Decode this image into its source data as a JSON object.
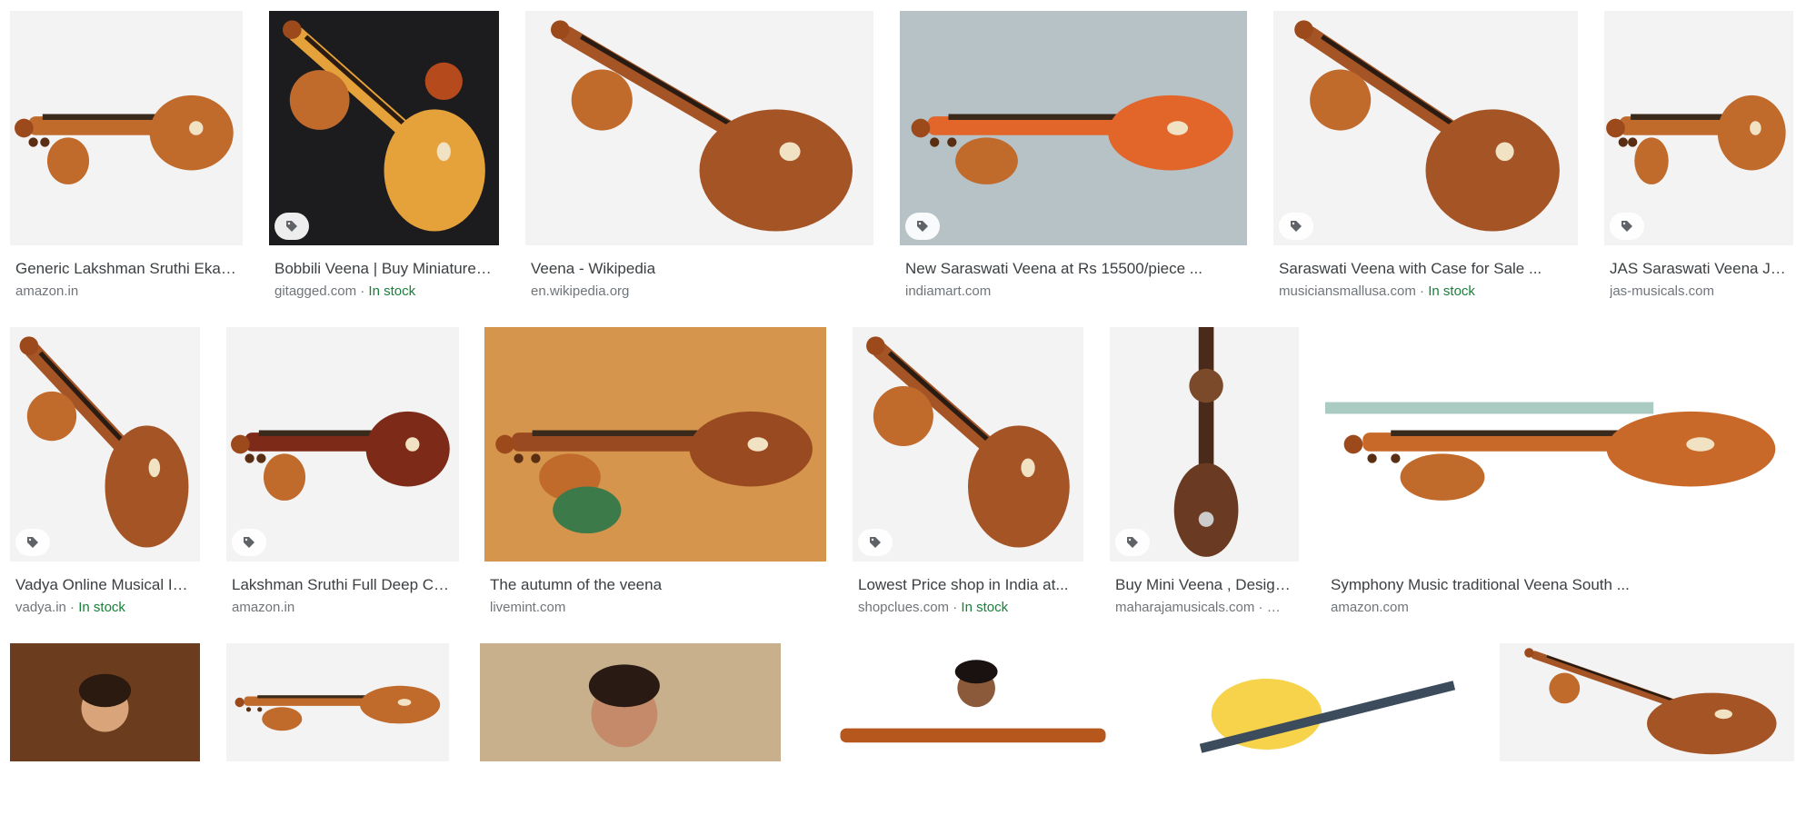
{
  "results": [
    {
      "title": "Generic Lakshman Sruthi Ekanda Veena",
      "source": "amazon.in",
      "stock": "",
      "tag_icon": false,
      "variant": "h-light"
    },
    {
      "title": "Bobbili Veena | Buy Miniature Veena",
      "source": "gitagged.com",
      "stock": "In stock",
      "tag_icon": true,
      "variant": "d-dark"
    },
    {
      "title": "Veena - Wikipedia",
      "source": "en.wikipedia.org",
      "stock": "",
      "tag_icon": false,
      "variant": "d-light"
    },
    {
      "title": "New Saraswati Veena at Rs 15500/piece ...",
      "source": "indiamart.com",
      "stock": "",
      "tag_icon": true,
      "variant": "h-orange"
    },
    {
      "title": "Saraswati Veena with Case for Sale ...",
      "source": "musiciansmallusa.com",
      "stock": "In stock",
      "tag_icon": true,
      "variant": "d-light"
    },
    {
      "title": "JAS Saraswati Veena JAS",
      "source": "jas-musicals.com",
      "stock": "",
      "tag_icon": true,
      "variant": "h-light"
    },
    {
      "title": "Vadya Online Musical Instruments",
      "source": "vadya.in",
      "stock": "In stock",
      "tag_icon": true,
      "variant": "d-light"
    },
    {
      "title": "Lakshman Sruthi Full Deep Carved Veena",
      "source": "amazon.in",
      "stock": "",
      "tag_icon": true,
      "variant": "h-red"
    },
    {
      "title": "The autumn of the veena",
      "source": "livemint.com",
      "stock": "",
      "tag_icon": false,
      "variant": "warm"
    },
    {
      "title": "Lowest Price shop in India at...",
      "source": "shopclues.com",
      "stock": "In stock",
      "tag_icon": true,
      "variant": "d-light"
    },
    {
      "title": "Buy Mini Veena , Designer Mini Veena",
      "source": "maharajamusicals.com · …",
      "stock": "",
      "tag_icon": true,
      "variant": "vertical"
    },
    {
      "title": "Symphony Music traditional Veena South ...",
      "source": "amazon.com",
      "stock": "",
      "tag_icon": false,
      "variant": "h-wide"
    },
    {
      "title": "",
      "source": "",
      "stock": "",
      "tag_icon": false,
      "variant": "painting"
    },
    {
      "title": "",
      "source": "",
      "stock": "",
      "tag_icon": false,
      "variant": "h-light"
    },
    {
      "title": "",
      "source": "",
      "stock": "",
      "tag_icon": false,
      "variant": "person"
    },
    {
      "title": "",
      "source": "",
      "stock": "",
      "tag_icon": false,
      "variant": "person-white"
    },
    {
      "title": "",
      "source": "",
      "stock": "",
      "tag_icon": false,
      "variant": "yellow"
    },
    {
      "title": "",
      "source": "",
      "stock": "",
      "tag_icon": false,
      "variant": "d-light"
    }
  ],
  "icons": {
    "tag": "price-tag-icon"
  },
  "colors": {
    "title": "#3c4043",
    "source": "#70757a",
    "in_stock": "#188038"
  }
}
